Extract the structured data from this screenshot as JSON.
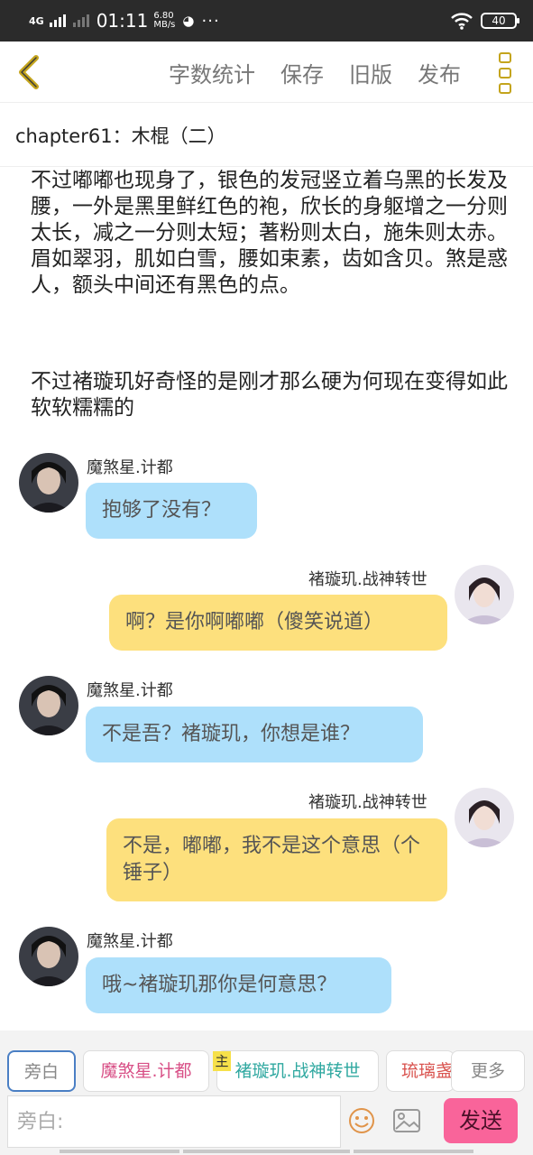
{
  "status_bar": {
    "network": "4G",
    "time": "01:11",
    "speed_value": "6.80",
    "speed_unit": "MB/s",
    "more": "···",
    "battery": "40"
  },
  "toolbar": {
    "word_count": "字数统计",
    "save": "保存",
    "old_version": "旧版",
    "publish": "发布"
  },
  "chapter": {
    "title": "chapter61：木棍（二）"
  },
  "narration": [
    "不过嘟嘟也现身了，银色的发冠竖立着乌黑的长发及腰，一外是黑里鲜红色的袍，欣长的身躯增之一分则太长，减之一分则太短；著粉则太白，施朱则太赤。眉如翠羽，肌如白雪，腰如束素，齿如含贝。煞是惑人，额头中间还有黑色的点。",
    "不过褚璇玑好奇怪的是刚才那么硬为何现在变得如此软软糯糯的"
  ],
  "messages": [
    {
      "speaker": "魔煞星.计都",
      "text": "抱够了没有？",
      "side": "left"
    },
    {
      "speaker": "褚璇玑.战神转世",
      "text": "啊？是你啊嘟嘟（傻笑说道）",
      "side": "right"
    },
    {
      "speaker": "魔煞星.计都",
      "text": "不是吾？褚璇玑，你想是谁？",
      "side": "left"
    },
    {
      "speaker": "褚璇玑.战神转世",
      "text": "不是，嘟嘟，我不是这个意思（个锤子）",
      "side": "right"
    },
    {
      "speaker": "魔煞星.计都",
      "text": "哦~褚璇玑那你是何意思？",
      "side": "left"
    }
  ],
  "characters": {
    "narration": "旁白",
    "c1": "魔煞星.计都",
    "host_tag": "主",
    "c2": "褚璇玑.战神转世",
    "c3": "琉璃盏",
    "more": "更多"
  },
  "input": {
    "placeholder": "旁白:",
    "send": "发送"
  },
  "colors": {
    "left_bubble": "#aee0fb",
    "right_bubble": "#fde07d",
    "send_button": "#f9649a",
    "accent": "#c4a41c",
    "chip_c1": "#d84f86",
    "chip_c2": "#2fa8a0",
    "chip_c3": "#d9534f"
  }
}
